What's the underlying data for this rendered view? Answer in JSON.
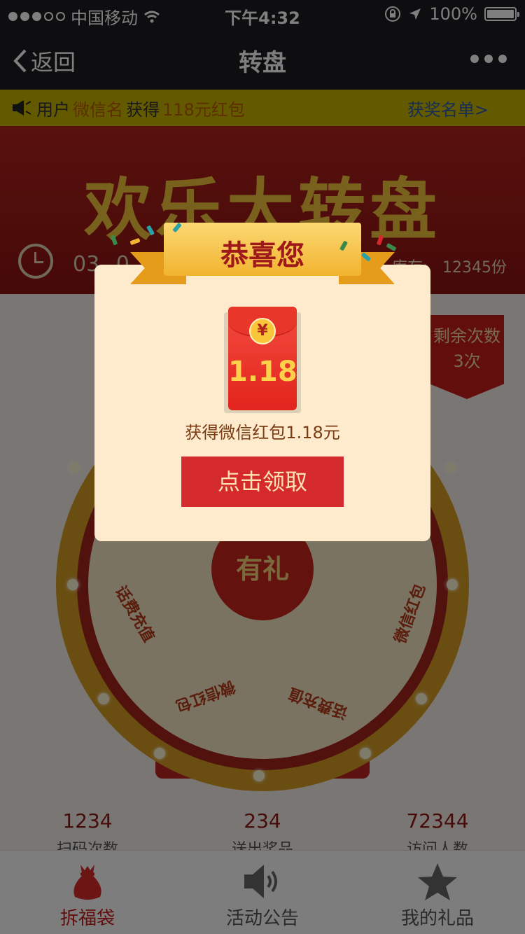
{
  "status_bar": {
    "carrier": "中国移动",
    "time": "下午4:32",
    "battery": "100%",
    "signal_bars": 3,
    "signal_total": 5
  },
  "nav": {
    "back_label": "返回",
    "title": "转盘"
  },
  "marquee": {
    "user_prefix": "用户",
    "user_name": "微信名",
    "action": "获得",
    "prize": "118元红包",
    "winners_link": "获奖名单>"
  },
  "banner": {
    "title": "欢乐大转盘",
    "countdown": "03",
    "countdown_tail": "0",
    "stock_label": "库存:",
    "stock": "12345份"
  },
  "wheel": {
    "remaining_label": "剩余次数",
    "remaining_count": "3次",
    "hub_label": "有礼",
    "segments": [
      "话费充值",
      "微信红包",
      "话费充值",
      "微信红包"
    ]
  },
  "stats": [
    {
      "value": "1234",
      "label": "扫码次数"
    },
    {
      "value": "234",
      "label": "送出奖品"
    },
    {
      "value": "72344",
      "label": "访问人数"
    }
  ],
  "tabs": [
    {
      "label": "拆福袋",
      "icon": "lucky-bag-icon",
      "active": true
    },
    {
      "label": "活动公告",
      "icon": "speaker-icon",
      "active": false
    },
    {
      "label": "我的礼品",
      "icon": "star-icon",
      "active": false
    }
  ],
  "modal": {
    "ribbon_title": "恭喜您",
    "currency_symbol": "¥",
    "amount": "1.18",
    "message": "获得微信红包1.18元",
    "claim_button": "点击领取"
  },
  "colors": {
    "nav_bg": "#1d1d20",
    "marquee_bg": "#c7b400",
    "primary_red": "#d42a2e",
    "modal_bg": "#feebcd",
    "gold": "#f2b42f"
  }
}
